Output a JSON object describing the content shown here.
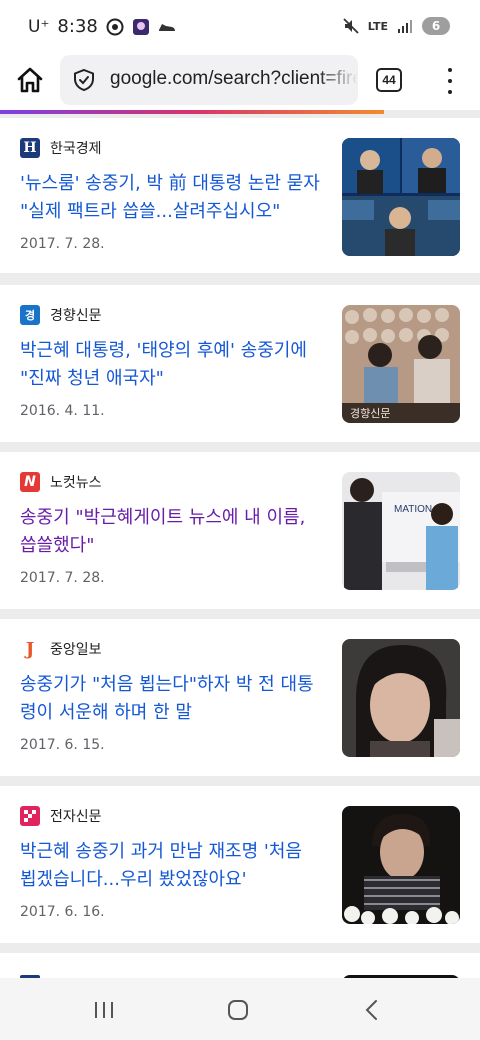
{
  "status": {
    "carrier": "U⁺",
    "time": "8:38",
    "network": "LTE",
    "battery": "6"
  },
  "browser": {
    "url": "google.com/search?client=firefox",
    "tab_count": "44"
  },
  "results": [
    {
      "source": "한국경제",
      "logo_letter": "H",
      "logo_color": "#1d3a7a",
      "title": "'뉴스룸' 송중기, 박 前 대통령 논란 묻자 \"실제 팩트라 씁쓸...살려주십시오\"",
      "date": "2017. 7. 28.",
      "visited": false
    },
    {
      "source": "경향신문",
      "logo_letter": "경",
      "logo_color": "#1a73c8",
      "title": "박근혜 대통령, '태양의 후예' 송중기에 \"진짜 청년 애국자\"",
      "date": "2016. 4. 11.",
      "visited": false
    },
    {
      "source": "노컷뉴스",
      "logo_letter": "N",
      "logo_color": "#e53935",
      "title": "송중기 \"박근혜게이트 뉴스에 내 이름, 씁쓸했다\"",
      "date": "2017. 7. 28.",
      "visited": true
    },
    {
      "source": "중앙일보",
      "logo_letter": "J",
      "logo_color": "#e8572a",
      "title": "송중기가 \"처음 뵙는다\"하자 박 전 대통령이 서운해 하며 한 말",
      "date": "2017. 6. 15.",
      "visited": false
    },
    {
      "source": "전자신문",
      "logo_letter": "",
      "logo_color": "#e0245e",
      "title": "박근혜 송중기 과거 만남 재조명 '처음 뵙겠습니다...우리 봤었잖아요'",
      "date": "2017. 6. 16.",
      "visited": false
    }
  ],
  "thumb_texts": {
    "khan_watermark": "경향신문",
    "mation_sign": "MATION"
  },
  "icons": {
    "home": "home-icon",
    "shield": "shield-icon",
    "menu": "more-vert-icon",
    "recents": "recents-icon",
    "home_nav": "home-nav-icon",
    "back": "back-icon"
  }
}
